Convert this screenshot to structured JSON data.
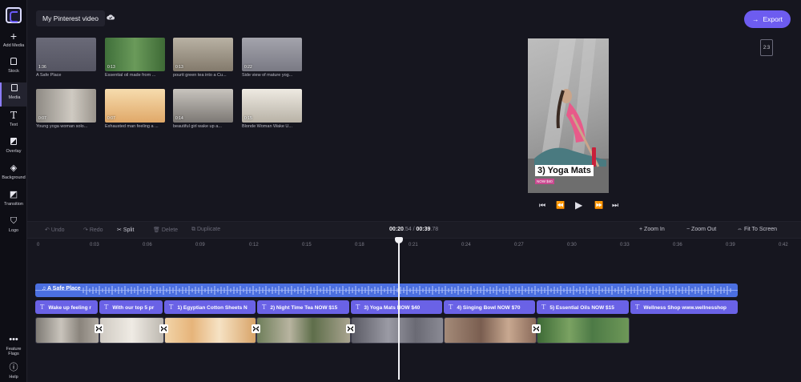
{
  "project": {
    "title": "My Pinterest video"
  },
  "export": {
    "label": "Export"
  },
  "aspect": {
    "label": "2:3"
  },
  "sidebar": {
    "items": [
      {
        "label": "Add Media",
        "icon": "plus-icon"
      },
      {
        "label": "Stock",
        "icon": "stock-icon"
      },
      {
        "label": "Media",
        "icon": "file-icon"
      },
      {
        "label": "Text",
        "icon": "text-icon"
      },
      {
        "label": "Overlay",
        "icon": "overlay-icon"
      },
      {
        "label": "Background",
        "icon": "layers-icon"
      },
      {
        "label": "Transition",
        "icon": "transition-icon"
      },
      {
        "label": "Logo",
        "icon": "shield-icon"
      }
    ],
    "bottom": [
      {
        "label": "Feature Flags",
        "icon": "ellipsis-icon"
      },
      {
        "label": "Help",
        "icon": "help-icon"
      }
    ]
  },
  "media": [
    {
      "duration": "1:36",
      "caption": "A Safe Place",
      "color": "#5e5e6c"
    },
    {
      "duration": "0:13",
      "caption": "Essential oil made from ...",
      "color": "#4f8a4a"
    },
    {
      "duration": "0:13",
      "caption": "pourit green tea into a Cu...",
      "color": "#9a8e7a"
    },
    {
      "duration": "0:22",
      "caption": "Side view of mature yog...",
      "color": "#8c8c94"
    },
    {
      "duration": "0:07",
      "caption": "Young yoga woman solo...",
      "color": "#b4b0a8"
    },
    {
      "duration": "0:07",
      "caption": "Exhausted man feeling a ...",
      "color": "#e8c08a"
    },
    {
      "duration": "0:14",
      "caption": "beautiful girl wake up a...",
      "color": "#a8a4a0"
    },
    {
      "duration": "0:15",
      "caption": "Blonde Woman Wake U...",
      "color": "#d4d0c8"
    }
  ],
  "preview": {
    "title": "3) Yoga Mats",
    "subtitle": "NOW $40"
  },
  "toolbar": {
    "undo": "Undo",
    "redo": "Redo",
    "split": "Split",
    "delete": "Delete",
    "duplicate": "Duplicate",
    "time_current": "00:20",
    "time_current_frac": ".54",
    "time_sep": "/",
    "time_total": "00:39",
    "time_total_frac": ".78",
    "zoom_in": "Zoom In",
    "zoom_out": "Zoom Out",
    "fit": "Fit To Screen"
  },
  "ruler": {
    "ticks": [
      "0",
      "0:03",
      "0:06",
      "0:09",
      "0:12",
      "0:15",
      "0:18",
      "0:21",
      "0:24",
      "0:27",
      "0:30",
      "0:33",
      "0:36",
      "0:39",
      "0:42"
    ]
  },
  "audio_track": {
    "label": "A Safe Place",
    "color": "#4b6fe0"
  },
  "text_clips": [
    {
      "label": "Wake up feeling r"
    },
    {
      "label": "With our top 5 pr"
    },
    {
      "label": "1) Egyptian Cotton Sheets N"
    },
    {
      "label": "2) Night Time Tea NOW $15"
    },
    {
      "label": "3) Yoga Mats NOW $40"
    },
    {
      "label": "4) Singing Bowl NOW $70"
    },
    {
      "label": "5) Essential Oils NOW $15"
    },
    {
      "label": "Wellness Shop www.wellnesshop"
    }
  ],
  "video_clips": [
    {
      "color": "#9d9890"
    },
    {
      "color": "#d8d4cc"
    },
    {
      "color": "#e2c49a"
    },
    {
      "color": "#7c8a6a"
    },
    {
      "color": "#8a8a96"
    },
    {
      "color": "#6e6a66"
    },
    {
      "color": "#8a6a5a"
    },
    {
      "color": "#4d7a46"
    }
  ],
  "colors": {
    "accent": "#6d5cf0",
    "text_clip": "#6a62e6",
    "pink_tag": "#c9488f"
  }
}
